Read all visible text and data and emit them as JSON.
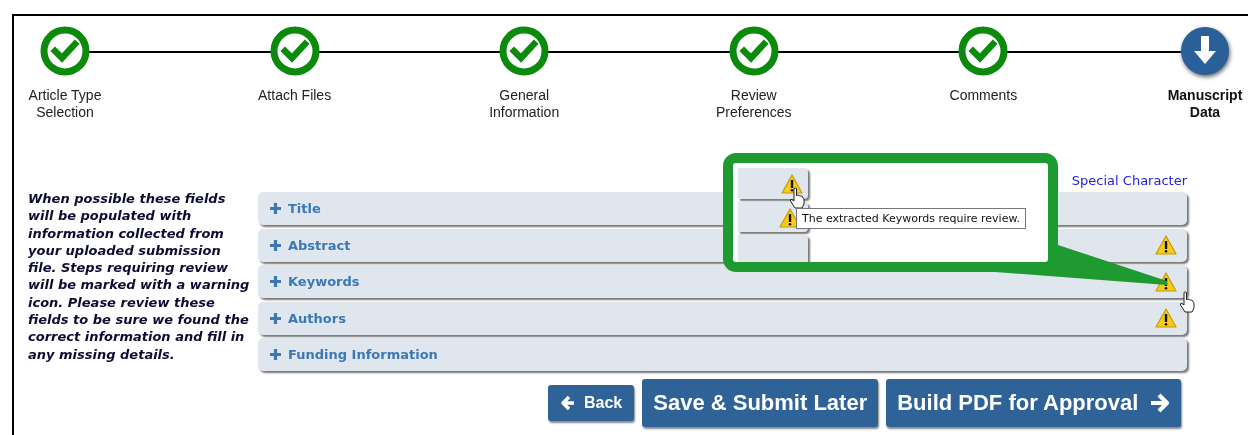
{
  "steps": [
    {
      "label": "Article Type Selection",
      "completed": true
    },
    {
      "label": "Attach Files",
      "completed": true
    },
    {
      "label": "General Information",
      "completed": true
    },
    {
      "label": "Review Preferences",
      "completed": true
    },
    {
      "label": "Comments",
      "completed": true
    },
    {
      "label": "Manuscript Data",
      "completed": false
    }
  ],
  "intro_text": "When possible these fields will be populated with information collected from your uploaded submission file. Steps requiring review will be marked with a warning icon. Please review these fields to be sure we found the correct information and fill in any missing details.",
  "special_character_link": "Special Character",
  "sections": [
    {
      "label": "Title",
      "warning": false
    },
    {
      "label": "Abstract",
      "warning": true
    },
    {
      "label": "Keywords",
      "warning": true
    },
    {
      "label": "Authors",
      "warning": true
    },
    {
      "label": "Funding Information",
      "warning": false
    }
  ],
  "buttons": [
    {
      "label": "Back",
      "kind": "back"
    },
    {
      "label": "Save & Submit Later",
      "kind": "plain"
    },
    {
      "label": "Build PDF for Approval",
      "kind": "next"
    }
  ],
  "callout": {
    "tooltip": "The extracted Keywords require review."
  }
}
